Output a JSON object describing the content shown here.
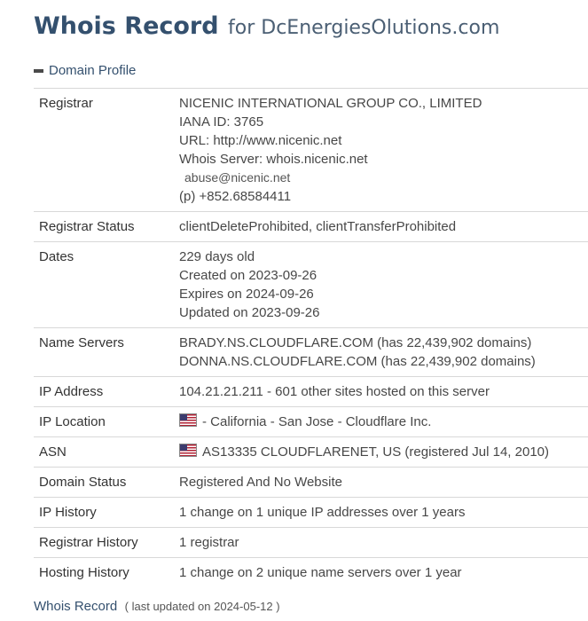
{
  "header": {
    "title": "Whois Record",
    "subtitle": "for DcEnergiesOlutions.com"
  },
  "section": {
    "toggle_label": "Domain Profile"
  },
  "profile": {
    "registrar": {
      "label": "Registrar",
      "name": "NICENIC INTERNATIONAL GROUP CO., LIMITED",
      "iana": "IANA ID: 3765",
      "url": "URL: http://www.nicenic.net",
      "whois_server": "Whois Server: whois.nicenic.net",
      "email": "abuse@nicenic.net",
      "phone": "(p) +852.68584411"
    },
    "registrar_status": {
      "label": "Registrar Status",
      "value": "clientDeleteProhibited, clientTransferProhibited"
    },
    "dates": {
      "label": "Dates",
      "age": "229 days old",
      "created": "Created on 2023-09-26",
      "expires": "Expires on 2024-09-26",
      "updated": "Updated on 2023-09-26"
    },
    "name_servers": {
      "label": "Name Servers",
      "ns1": "BRADY.NS.CLOUDFLARE.COM (has 22,439,902 domains)",
      "ns2": "DONNA.NS.CLOUDFLARE.COM (has 22,439,902 domains)"
    },
    "ip_address": {
      "label": "IP Address",
      "value": "104.21.21.211 - 601 other sites hosted on this server"
    },
    "ip_location": {
      "label": "IP Location",
      "value": "- California - San Jose - Cloudflare Inc."
    },
    "asn": {
      "label": "ASN",
      "value": "AS13335 CLOUDFLARENET, US (registered Jul 14, 2010)"
    },
    "domain_status": {
      "label": "Domain Status",
      "value": "Registered And No Website"
    },
    "ip_history": {
      "label": "IP History",
      "value": "1 change on 1 unique IP addresses over 1 years"
    },
    "registrar_history": {
      "label": "Registrar History",
      "value": "1 registrar"
    },
    "hosting_history": {
      "label": "Hosting History",
      "value": "1 change on 2 unique name servers over 1 year"
    }
  },
  "footer": {
    "title": "Whois Record",
    "note": "( last updated on 2024-05-12 )"
  },
  "icons": {
    "collapse": "minus-icon",
    "flag": "us-flag-icon"
  },
  "colors": {
    "heading": "#34506e",
    "row_border": "#d8d8d8"
  }
}
